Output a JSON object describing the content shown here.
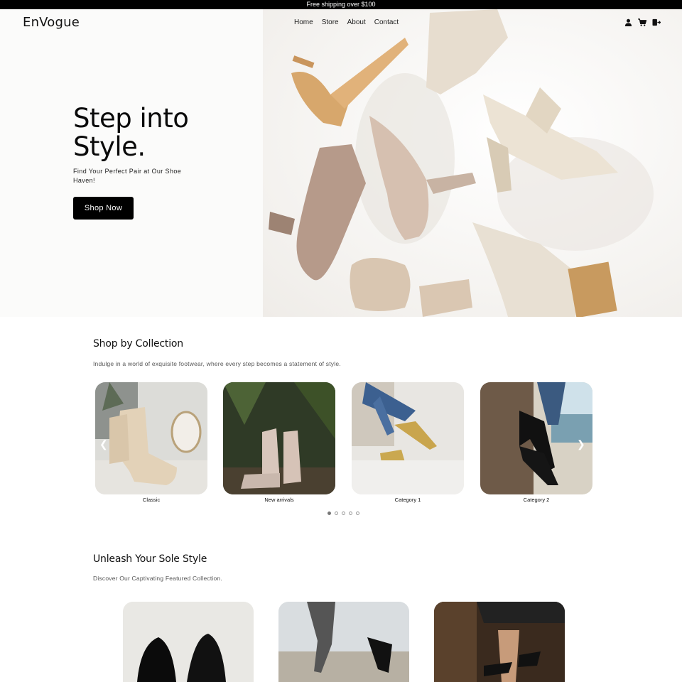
{
  "announcement": "Free shipping over $100",
  "header": {
    "logo": "EnVogue",
    "nav": [
      "Home",
      "Store",
      "About",
      "Contact"
    ],
    "icons": [
      "user-icon",
      "cart-icon",
      "logout-icon"
    ]
  },
  "hero": {
    "title_line1": "Step into",
    "title_line2": "Style.",
    "subtitle": "Find Your Perfect Pair at Our Shoe Haven!",
    "cta": "Shop Now"
  },
  "collection": {
    "title": "Shop by Collection",
    "subtitle": "Indulge in a world of exquisite footwear, where every step becomes a statement of style.",
    "items": [
      {
        "label": "Classic"
      },
      {
        "label": "New arrivals"
      },
      {
        "label": "Category 1"
      },
      {
        "label": "Category 2"
      }
    ],
    "prev_icon": "chevron-left-icon",
    "next_icon": "chevron-right-icon",
    "active_dot": 1,
    "dot_count": 5
  },
  "featured": {
    "title": "Unleash Your Sole Style",
    "subtitle": "Discover Our Captivating Featured Collection."
  },
  "colors": {
    "accent": "#000000",
    "background": "#ffffff"
  }
}
